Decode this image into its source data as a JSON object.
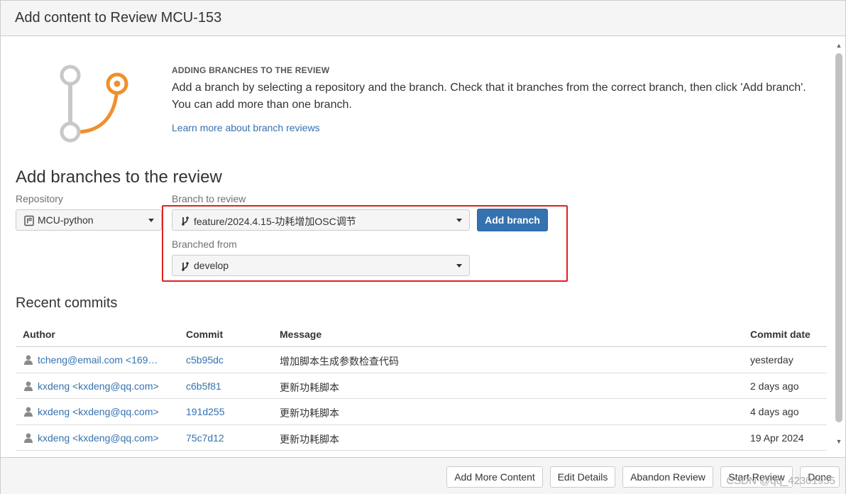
{
  "dialog": {
    "title": "Add content to Review MCU-153"
  },
  "intro": {
    "heading": "ADDING BRANCHES TO THE REVIEW",
    "text": "Add a branch by selecting a repository and the branch. Check that it branches from the correct branch, then click 'Add branch'. You can add more than one branch.",
    "link": "Learn more about branch reviews"
  },
  "form": {
    "section_title": "Add branches to the review",
    "repository_label": "Repository",
    "repository_value": "MCU-python",
    "branch_label": "Branch to review",
    "branch_value": "feature/2024.4.15-功耗增加OSC调节",
    "branched_from_label": "Branched from",
    "branched_from_value": "develop",
    "add_branch_label": "Add branch"
  },
  "recent": {
    "title": "Recent commits",
    "columns": [
      "Author",
      "Commit",
      "Message",
      "Commit date"
    ],
    "rows": [
      {
        "author": "tcheng@email.com <169…",
        "commit": "c5b95dc",
        "message": "增加脚本生成参数检查代码",
        "date": "yesterday"
      },
      {
        "author": "kxdeng <kxdeng@qq.com>",
        "commit": "c6b5f81",
        "message": "更新功耗脚本",
        "date": "2 days ago"
      },
      {
        "author": "kxdeng <kxdeng@qq.com>",
        "commit": "191d255",
        "message": "更新功耗脚本",
        "date": "4 days ago"
      },
      {
        "author": "kxdeng <kxdeng@qq.com>",
        "commit": "75c7d12",
        "message": "更新功耗脚本",
        "date": "19 Apr 2024"
      }
    ]
  },
  "footer": {
    "add_more": "Add More Content",
    "edit_details": "Edit Details",
    "abandon": "Abandon Review",
    "start": "Start Review",
    "done": "Done"
  },
  "watermark": "CSDN @qq_42301955",
  "colors": {
    "accent": "#3572b0",
    "branch_orange": "#f0902a",
    "highlight": "#e02020"
  }
}
